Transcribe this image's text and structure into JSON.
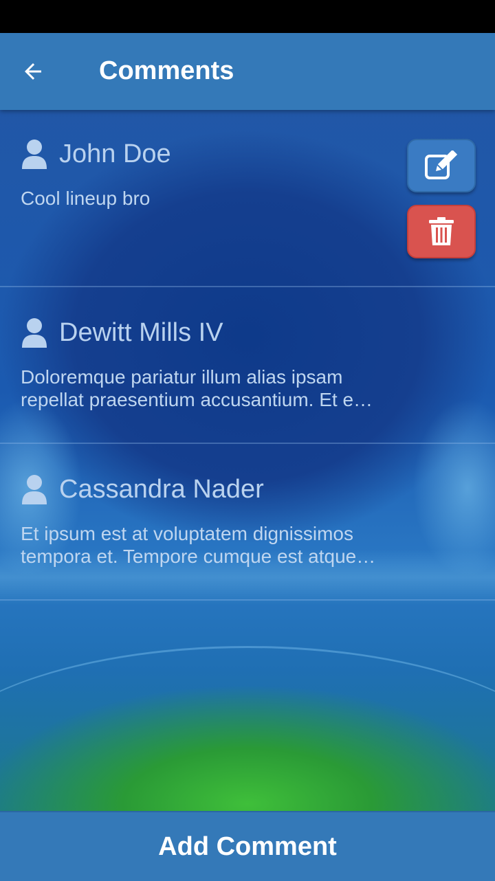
{
  "header": {
    "title": "Comments",
    "back_icon": "arrow-left-icon"
  },
  "comments": [
    {
      "author": "John Doe",
      "text": "Cool lineup bro",
      "actions": {
        "edit_icon": "edit-icon",
        "delete_icon": "trash-icon"
      }
    },
    {
      "author": "Dewitt Mills IV",
      "text": "Doloremque pariatur illum alias ipsam repellat praesentium accusantium. Et e…"
    },
    {
      "author": "Cassandra Nader",
      "text": "Et ipsum est at voluptatem dignissimos tempora et. Tempore cumque est atque…"
    }
  ],
  "footer": {
    "add_label": "Add Comment"
  },
  "colors": {
    "app_bar": "#3479b8",
    "edit_button": "#3a7bc3",
    "delete_button": "#d9534f",
    "text": "#bfd6f0"
  }
}
